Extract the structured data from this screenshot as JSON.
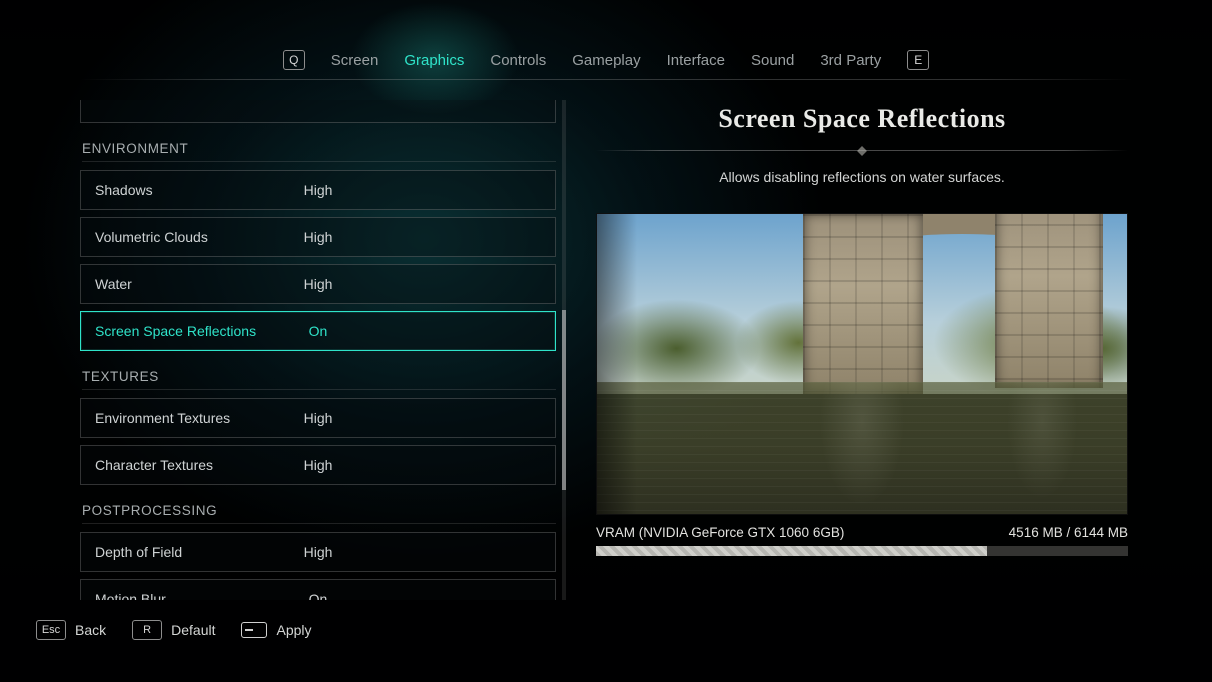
{
  "tabs": {
    "prev_key": "Q",
    "next_key": "E",
    "items": [
      "Screen",
      "Graphics",
      "Controls",
      "Gameplay",
      "Interface",
      "Sound",
      "3rd Party"
    ],
    "active_index": 1
  },
  "sections": [
    {
      "header": "ENVIRONMENT",
      "options": [
        {
          "label": "Shadows",
          "value": "High",
          "selected": false
        },
        {
          "label": "Volumetric Clouds",
          "value": "High",
          "selected": false
        },
        {
          "label": "Water",
          "value": "High",
          "selected": false
        },
        {
          "label": "Screen Space Reflections",
          "value": "On",
          "selected": true
        }
      ]
    },
    {
      "header": "TEXTURES",
      "options": [
        {
          "label": "Environment Textures",
          "value": "High",
          "selected": false
        },
        {
          "label": "Character Textures",
          "value": "High",
          "selected": false
        }
      ]
    },
    {
      "header": "POSTPROCESSING",
      "options": [
        {
          "label": "Depth of Field",
          "value": "High",
          "selected": false
        },
        {
          "label": "Motion Blur",
          "value": "On",
          "selected": false
        }
      ]
    }
  ],
  "detail": {
    "title": "Screen Space Reflections",
    "description": "Allows disabling reflections on water surfaces."
  },
  "vram": {
    "label": "VRAM (NVIDIA GeForce GTX 1060 6GB)",
    "used_mb": 4516,
    "total_mb": 6144,
    "display": "4516 MB / 6144 MB"
  },
  "footer": {
    "back": {
      "key": "Esc",
      "label": "Back"
    },
    "default": {
      "key": "R",
      "label": "Default"
    },
    "apply": {
      "label": "Apply"
    }
  }
}
